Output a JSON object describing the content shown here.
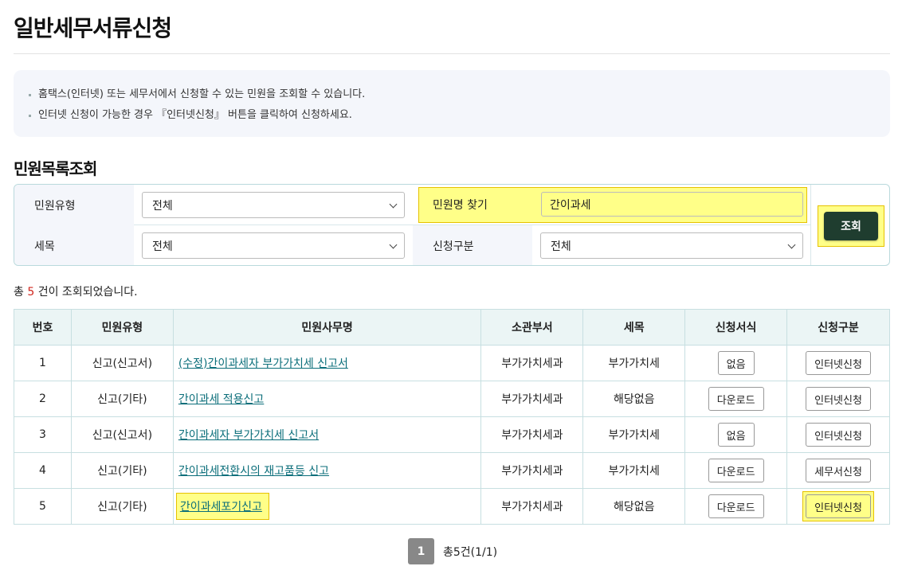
{
  "page": {
    "title": "일반세무서류신청"
  },
  "info": {
    "lines": [
      "홈택스(인터넷) 또는 세무서에서 신청할 수 있는 민원을 조회할 수 있습니다.",
      "인터넷 신청이 가능한 경우 『인터넷신청』 버튼을 클릭하여 신청하세요."
    ]
  },
  "search": {
    "section_title": "민원목록조회",
    "type_label": "민원유형",
    "type_value": "전체",
    "name_label": "민원명 찾기",
    "name_value": "간이과세",
    "tax_label": "세목",
    "tax_value": "전체",
    "apply_label": "신청구분",
    "apply_value": "전체",
    "button_label": "조회"
  },
  "results": {
    "prefix": "총",
    "count": "5",
    "suffix": "건이 조회되었습니다."
  },
  "table": {
    "headers": [
      "번호",
      "민원유형",
      "민원사무명",
      "소관부서",
      "세목",
      "신청서식",
      "신청구분"
    ],
    "rows": [
      {
        "no": "1",
        "type": "신고(신고서)",
        "name": "(수정)간이과세자 부가가치세 신고서",
        "dept": "부가가치세과",
        "tax": "부가가치세",
        "form": "없음",
        "apply": "인터넷신청"
      },
      {
        "no": "2",
        "type": "신고(기타)",
        "name": "간이과세 적용신고",
        "dept": "부가가치세과",
        "tax": "해당없음",
        "form": "다운로드",
        "apply": "인터넷신청"
      },
      {
        "no": "3",
        "type": "신고(신고서)",
        "name": "간이과세자 부가가치세 신고서",
        "dept": "부가가치세과",
        "tax": "부가가치세",
        "form": "없음",
        "apply": "인터넷신청"
      },
      {
        "no": "4",
        "type": "신고(기타)",
        "name": "간이과세전환시의 재고품등 신고",
        "dept": "부가가치세과",
        "tax": "부가가치세",
        "form": "다운로드",
        "apply": "세무서신청"
      },
      {
        "no": "5",
        "type": "신고(기타)",
        "name": "간이과세포기신고",
        "dept": "부가가치세과",
        "tax": "해당없음",
        "form": "다운로드",
        "apply": "인터넷신청"
      }
    ]
  },
  "pagination": {
    "current": "1",
    "summary": "총5건(1/1)"
  },
  "colors": {
    "accent_button": "#1f3d2f",
    "link": "#0b6e7a",
    "highlight": "#ffff88",
    "count": "#d0251c"
  }
}
